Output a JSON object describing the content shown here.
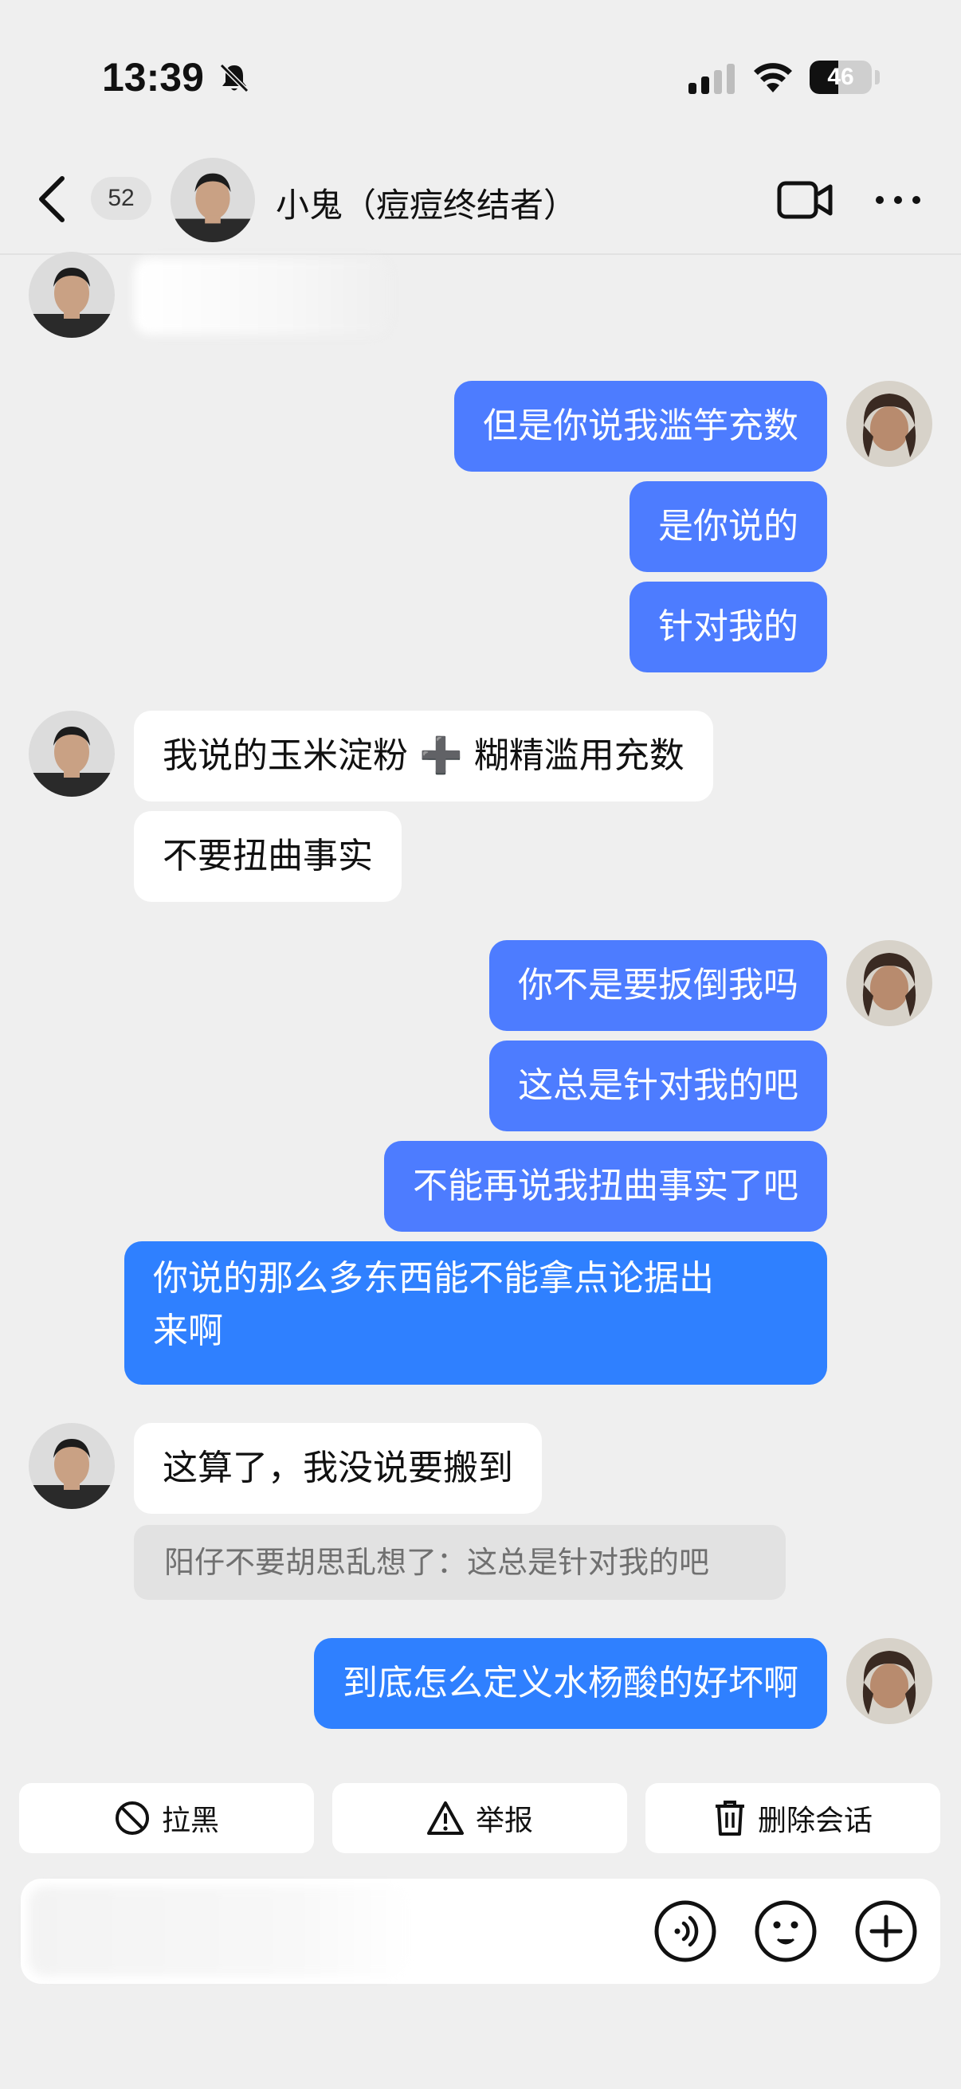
{
  "status_bar": {
    "time": "13:39",
    "battery": "46",
    "battery_level": 0.46
  },
  "header": {
    "unread_count": "52",
    "contact_name": "小鬼（痘痘终结者）"
  },
  "messages": {
    "sent_1": "但是你说我滥竽充数",
    "sent_2": "是你说的",
    "sent_3": "针对我的",
    "recv_1": "我说的玉米淀粉 ➕ 糊精滥用充数",
    "recv_2": "不要扭曲事实",
    "sent_4": "你不是要扳倒我吗",
    "sent_5": "这总是针对我的吧",
    "sent_6": "不能再说我扭曲事实了吧",
    "sent_7_line1": "你说的那么多东西能不能拿点论据出",
    "sent_7_line2": "来啊",
    "recv_3": "这算了，我没说要搬到",
    "quote": "阳仔不要胡思乱想了：这总是针对我的吧",
    "sent_8": "到底怎么定义水杨酸的好坏啊"
  },
  "actions": {
    "block": "拉黑",
    "report": "举报",
    "delete": "删除会话"
  },
  "icons": {
    "back": "chevron-left-icon",
    "video": "video-call-icon",
    "more": "more-dots-icon",
    "block": "block-icon",
    "report": "warning-icon",
    "delete": "trash-icon",
    "voice": "voice-icon",
    "emoji": "emoji-icon",
    "plus": "plus-icon"
  },
  "colors": {
    "sent_bubble": "#4d7cff",
    "sent_bubble_bright": "#2f80ff",
    "received_bubble": "#ffffff",
    "background": "#efefef"
  }
}
